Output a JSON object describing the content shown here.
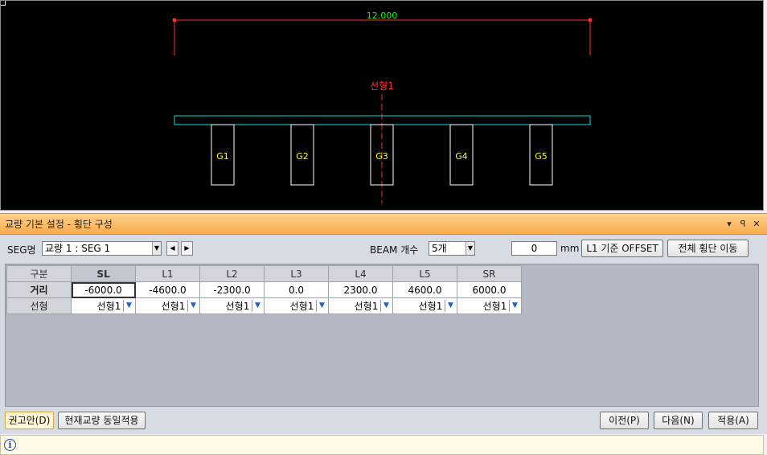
{
  "canvas": {
    "dimension_label": "12.000",
    "alignment_label": "선형1",
    "girders": [
      "G1",
      "G2",
      "G3",
      "G4",
      "G5"
    ],
    "colors": {
      "dimension": "#00ff00",
      "extension": "#ff0000",
      "alignment": "#ff2020",
      "deck": "#00e0e0",
      "girder": "#ffffff",
      "girder_label": "#ffff00"
    }
  },
  "panel": {
    "title": "교량 기본 설정 - 횡단 구성",
    "pin_icon": "▾",
    "dock_icon": "ꟼ",
    "close_icon": "✕"
  },
  "toolbar": {
    "seg_label": "SEG명",
    "seg_value": "교량 1 : SEG 1",
    "beam_label": "BEAM 개수",
    "beam_value": "5개",
    "offset_value": "0",
    "offset_unit": "mm",
    "offset_button": "L1 기준 OFFSET",
    "move_button": "전체 횡단 이동"
  },
  "grid": {
    "corner": "구분",
    "columns": [
      "SL",
      "L1",
      "L2",
      "L3",
      "L4",
      "L5",
      "SR"
    ],
    "row_distance_label": "거리",
    "distances": [
      "-6000.0",
      "-4600.0",
      "-2300.0",
      "0.0",
      "2300.0",
      "4600.0",
      "6000.0"
    ],
    "row_alignment_label": "선형",
    "alignments": [
      "선형1",
      "선형1",
      "선형1",
      "선형1",
      "선형1",
      "선형1",
      "선형1"
    ]
  },
  "footer": {
    "recommend": "권고안(D)",
    "apply_same": "현재교량 동일적용",
    "prev": "이전(P)",
    "next": "다음(N)",
    "apply": "적용(A)"
  },
  "status": {
    "info_icon": "i"
  }
}
